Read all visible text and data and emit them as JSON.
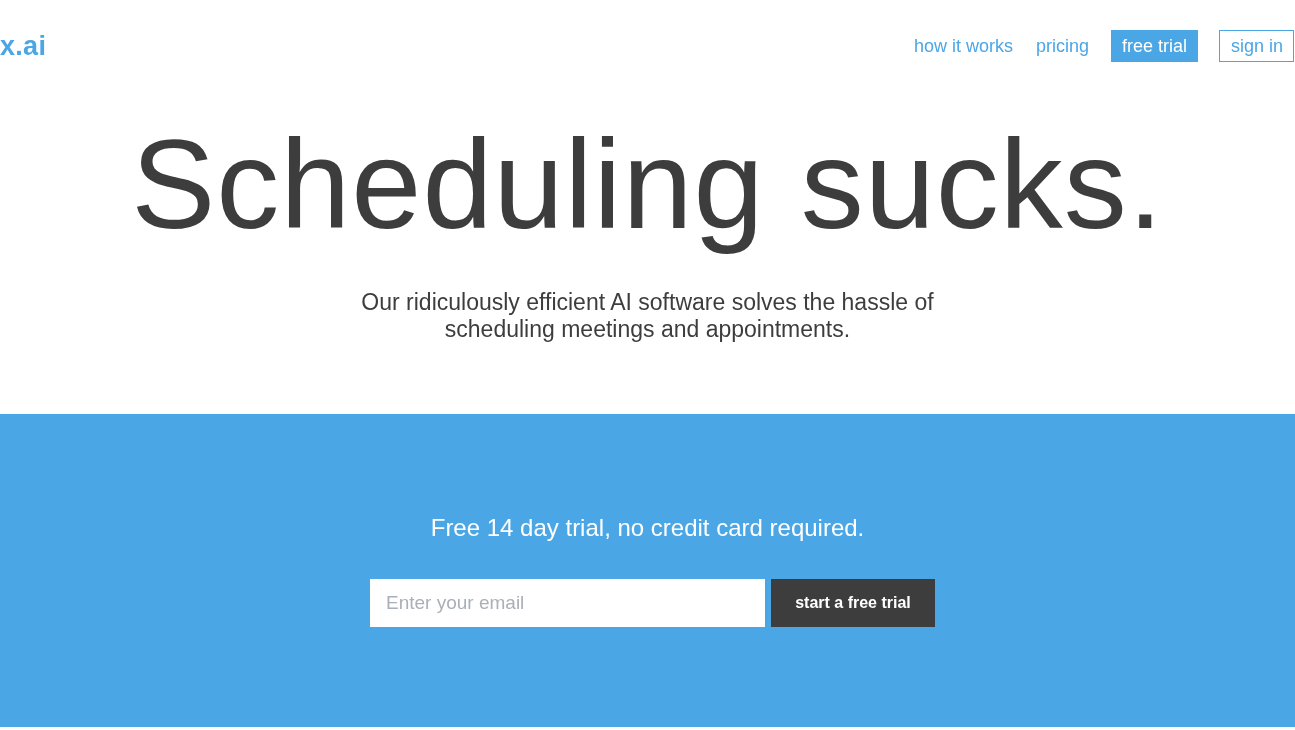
{
  "logo": {
    "text": "x.ai"
  },
  "nav": [
    {
      "label": "how it works",
      "kind": "link"
    },
    {
      "label": "pricing",
      "kind": "link"
    },
    {
      "label": "free trial",
      "kind": "filled"
    },
    {
      "label": "sign in",
      "kind": "outlined"
    }
  ],
  "hero": {
    "headline": "Scheduling sucks.",
    "subtitle": "Our ridiculously efficient AI software solves the hassle of scheduling meetings and appointments."
  },
  "signup": {
    "tagline": "Free 14 day trial, no credit card required.",
    "email": {
      "placeholder": "Enter your email"
    },
    "button": "start a free trial"
  }
}
